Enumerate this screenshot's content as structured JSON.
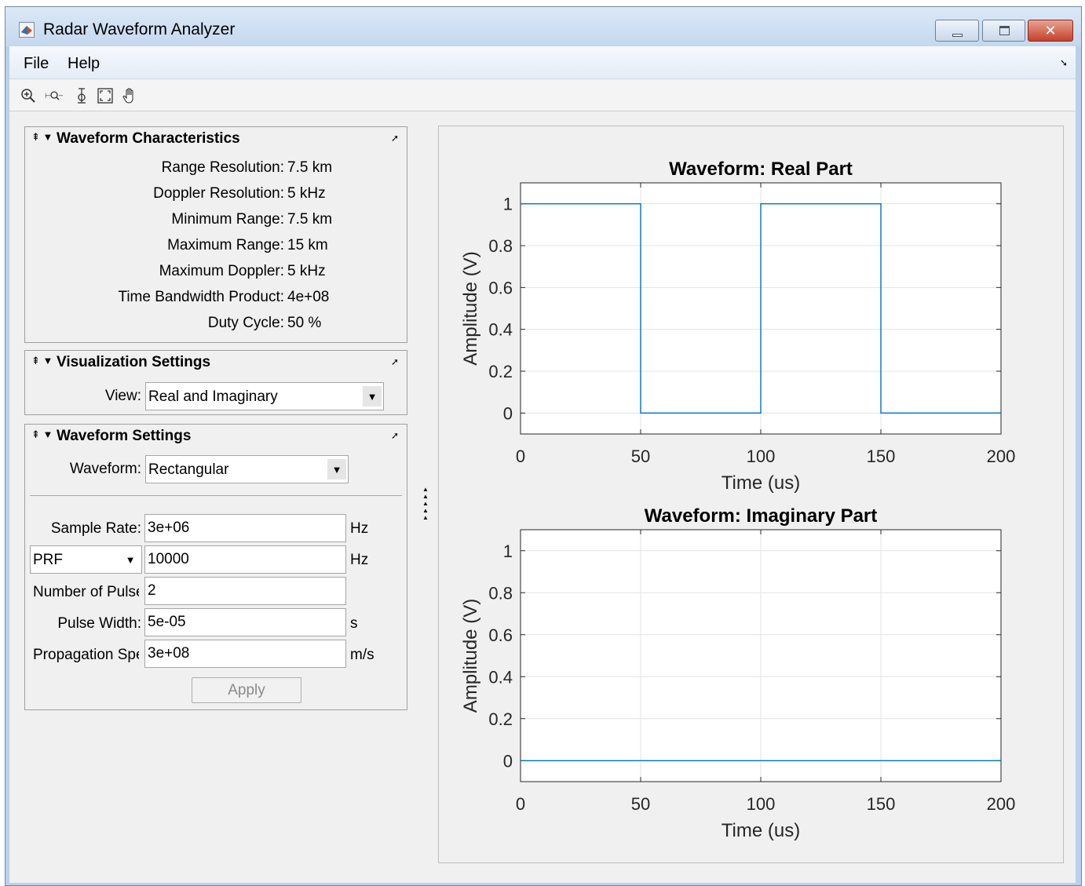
{
  "window": {
    "title": "Radar Waveform Analyzer"
  },
  "menu": {
    "file": "File",
    "help": "Help"
  },
  "toolbar": {
    "tools": [
      "zoom-in-icon",
      "zoom-out-icon",
      "data-cursor-icon",
      "restore-view-icon",
      "pan-hand-icon"
    ]
  },
  "characteristics": {
    "title": "Waveform Characteristics",
    "rows": [
      {
        "label": "Range Resolution:",
        "value": "7.5 km"
      },
      {
        "label": "Doppler Resolution:",
        "value": "5 kHz"
      },
      {
        "label": "Minimum Range:",
        "value": "7.5 km"
      },
      {
        "label": "Maximum Range:",
        "value": "15 km"
      },
      {
        "label": "Maximum Doppler:",
        "value": "5 kHz"
      },
      {
        "label": "Time Bandwidth Product:",
        "value": "4e+08"
      },
      {
        "label": "Duty Cycle:",
        "value": "50 %"
      }
    ]
  },
  "visualization": {
    "title": "Visualization Settings",
    "view_label": "View:",
    "view_value": "Real and Imaginary"
  },
  "waveform_settings": {
    "title": "Waveform Settings",
    "waveform_label": "Waveform:",
    "waveform_value": "Rectangular",
    "sample_rate_label": "Sample Rate:",
    "sample_rate_value": "3e+06",
    "sample_rate_unit": "Hz",
    "prf_select": "PRF",
    "prf_value": "10000",
    "prf_unit": "Hz",
    "num_pulses_label": "Number of Pulses:",
    "num_pulses_value": "2",
    "pulse_width_label": "Pulse Width:",
    "pulse_width_value": "5e-05",
    "pulse_width_unit": "s",
    "propagation_label": "Propagation Speed:",
    "propagation_value": "3e+08",
    "propagation_unit": "m/s",
    "apply_label": "Apply"
  },
  "chart_data": [
    {
      "type": "line",
      "title": "Waveform: Real Part",
      "xlabel": "Time (us)",
      "ylabel": "Amplitude (V)",
      "xlim": [
        0,
        200
      ],
      "ylim": [
        -0.1,
        1.1
      ],
      "xticks": [
        0,
        50,
        100,
        150,
        200
      ],
      "yticks": [
        0,
        0.2,
        0.4,
        0.6,
        0.8,
        1
      ],
      "ytick_labels": [
        "0",
        "0.2",
        "0.4",
        "0.6",
        "0.8",
        "1"
      ],
      "grid": true,
      "color": "#0072BD",
      "series": [
        {
          "x": [
            0,
            50,
            50,
            100,
            100,
            150,
            150,
            200
          ],
          "y": [
            1,
            1,
            0,
            0,
            1,
            1,
            0,
            0
          ]
        }
      ]
    },
    {
      "type": "line",
      "title": "Waveform: Imaginary Part",
      "xlabel": "Time (us)",
      "ylabel": "Amplitude (V)",
      "xlim": [
        0,
        200
      ],
      "ylim": [
        -0.1,
        1.1
      ],
      "xticks": [
        0,
        50,
        100,
        150,
        200
      ],
      "yticks": [
        0,
        0.2,
        0.4,
        0.6,
        0.8,
        1
      ],
      "ytick_labels": [
        "0",
        "0.2",
        "0.4",
        "0.6",
        "0.8",
        "1"
      ],
      "grid": true,
      "color": "#0072BD",
      "series": [
        {
          "x": [
            0,
            200
          ],
          "y": [
            0,
            0
          ]
        }
      ]
    }
  ]
}
